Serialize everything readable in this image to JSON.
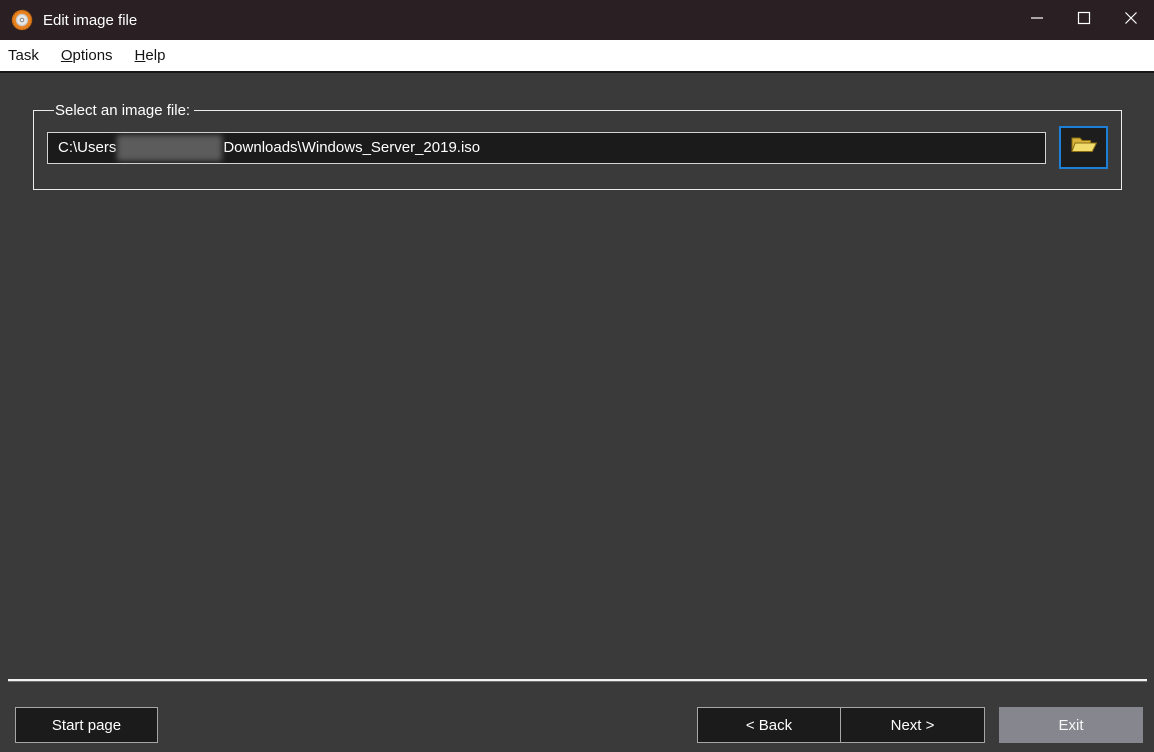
{
  "window": {
    "title": "Edit image file",
    "icon": "disc-icon",
    "controls": {
      "minimize": "minimize-icon",
      "maximize": "maximize-icon",
      "close": "close-icon"
    }
  },
  "menubar": {
    "items": [
      {
        "label": "Task",
        "accelerator_underlined": false
      },
      {
        "label": "Options",
        "accelerator_underlined": true
      },
      {
        "label": "Help",
        "accelerator_underlined": true
      }
    ]
  },
  "form": {
    "group_label": "Select an image file:",
    "file_path": {
      "visible_prefix": "C:\\Users",
      "redacted_segment": true,
      "visible_suffix": "Downloads\\Windows_Server_2019.iso"
    },
    "browse_icon": "open-folder-icon"
  },
  "footer": {
    "start_page_label": "Start page",
    "back_label": "< Back",
    "next_label": "Next >",
    "exit_label": "Exit"
  },
  "colors": {
    "titlebar_bg": "#2a2024",
    "menubar_bg": "#ffffff",
    "window_bg": "#3a3a3a",
    "field_bg": "#1b1b1b",
    "button_bg": "#1b1b1b",
    "button_border": "#a6a6a6",
    "exit_button_bg": "#85868e",
    "focus_border": "#1d7fd6",
    "folder_icon": "#f2dc6e",
    "app_icon_ring": "#e8821e"
  }
}
